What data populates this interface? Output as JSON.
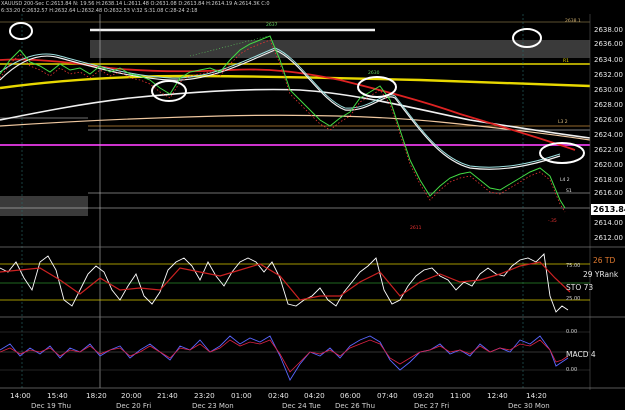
{
  "header": {
    "line1": "XAUUSD 200-Sec C:2613.84 N: 19.56 H:2638.14 L:2611.48 O:2631.08 D:2613.84 H:2614.19 A:2614.3K C:0",
    "line2": "6:33:20 C:2632.57 H:2632.64 L:2632.48 O:2632.53 V:32 S:31.08 C:28-24 2:18"
  },
  "price_scale": {
    "ticks": [
      "2638.00",
      "2636.00",
      "2634.00",
      "2632.00",
      "2630.00",
      "2628.00",
      "2626.00",
      "2624.00",
      "2622.00",
      "2620.00",
      "2618.00",
      "2616.00",
      "2614.00",
      "2612.00",
      "2610.00"
    ],
    "current": "2613.84"
  },
  "line_tags": {
    "top": "2638.1",
    "peak": "2637",
    "r1": "R1",
    "mid": "2630",
    "l3": "L3 2",
    "l4": "L4 2",
    "s1": "S1",
    "low": "2611",
    "dip": "-.35"
  },
  "stoch_panel": {
    "td": "26 TD",
    "rank": "29 YRank",
    "sto": "STO  73",
    "level_hi": "75.00",
    "level_lo": "25.00"
  },
  "macd_panel": {
    "label": "MACD 4",
    "level_hi": "0.00",
    "level_lo": "0.00"
  },
  "time_axis": [
    "14:00",
    "15:40",
    "18:20",
    "20:00",
    "21:40",
    "23:20",
    "01:00",
    "02:40",
    "04:20",
    "06:00",
    "07:40",
    "09:20",
    "11:00",
    "12:40",
    "14:20"
  ],
  "date_axis": [
    "Dec 19 Thu",
    "Dec 20 Fri",
    "Dec 23 Mon",
    "Dec 24 Tue",
    "Dec 26 Thu",
    "Dec 27 Fri",
    "Dec 30 Mon"
  ],
  "colors": {
    "background": "#000000",
    "candle_up": "#44dd44",
    "candle_down": "#ee3333",
    "resistance_yellow": "#e8d800",
    "pivot_magenta": "#cc33cc",
    "ma_red": "#dd2222",
    "ma_white": "#f0f0f0",
    "ma_cyan": "#9ee0e0",
    "stoch_white": "#ffffff",
    "stoch_red": "#cc2222",
    "macd_blue": "#5a66ff",
    "macd_red": "#dd2244"
  }
}
